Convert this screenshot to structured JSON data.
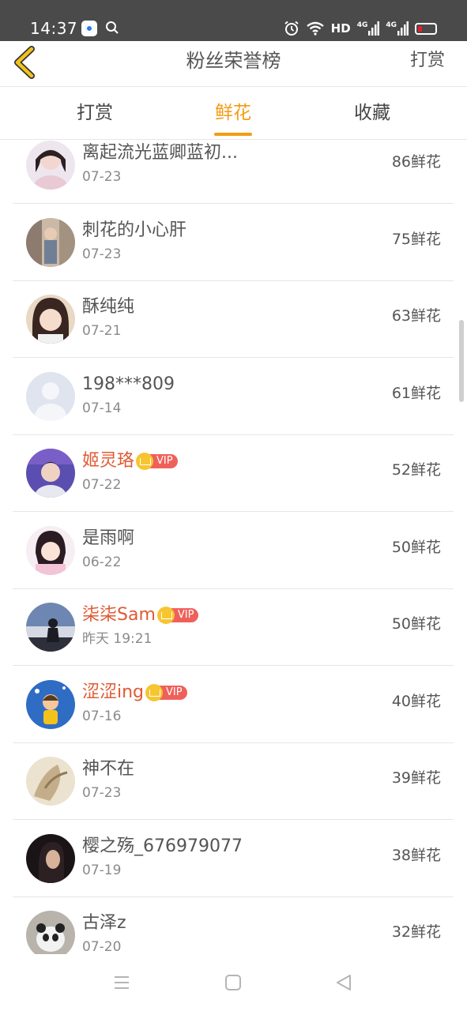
{
  "status_bar": {
    "time": "14:37",
    "hd": "HD",
    "net1": "4G",
    "net2": "4G",
    "app_icon": "app-icon",
    "battery_color": "#e0202c"
  },
  "header": {
    "title": "粉丝荣誉榜",
    "action": "打赏",
    "back_icon": "chevron-left-icon",
    "back_color": "#f3c21b"
  },
  "tabs": [
    {
      "label": "打赏",
      "active": false
    },
    {
      "label": "鲜花",
      "active": true
    },
    {
      "label": "收藏",
      "active": false
    }
  ],
  "accent_color": "#f39c12",
  "vip_name_color": "#e05a32",
  "list": [
    {
      "name": "离起流光蓝卿蓝初...",
      "date": "07-23",
      "value": "86鲜花",
      "vip": false,
      "vip_label": ""
    },
    {
      "name": "刺花的小心肝",
      "date": "07-23",
      "value": "75鲜花",
      "vip": false,
      "vip_label": ""
    },
    {
      "name": "酥纯纯",
      "date": "07-21",
      "value": "63鲜花",
      "vip": false,
      "vip_label": ""
    },
    {
      "name": "198***809",
      "date": "07-14",
      "value": "61鲜花",
      "vip": false,
      "vip_label": ""
    },
    {
      "name": "姬灵珞",
      "date": "07-22",
      "value": "52鲜花",
      "vip": true,
      "vip_label": "VIP"
    },
    {
      "name": "是雨啊",
      "date": "06-22",
      "value": "50鲜花",
      "vip": false,
      "vip_label": ""
    },
    {
      "name": "柒柒Sam",
      "date": "昨天 19:21",
      "value": "50鲜花",
      "vip": true,
      "vip_label": "VIP"
    },
    {
      "name": "涩涩ing",
      "date": "07-16",
      "value": "40鲜花",
      "vip": true,
      "vip_label": "VIP"
    },
    {
      "name": "神不在",
      "date": "07-23",
      "value": "39鲜花",
      "vip": false,
      "vip_label": ""
    },
    {
      "name": "樱之殇_676979077",
      "date": "07-19",
      "value": "38鲜花",
      "vip": false,
      "vip_label": ""
    },
    {
      "name": "古泽z",
      "date": "07-20",
      "value": "32鲜花",
      "vip": false,
      "vip_label": ""
    }
  ],
  "nav_bar": {
    "menu_icon": "menu-icon",
    "home_icon": "home-square-icon",
    "back_icon": "back-triangle-icon"
  }
}
